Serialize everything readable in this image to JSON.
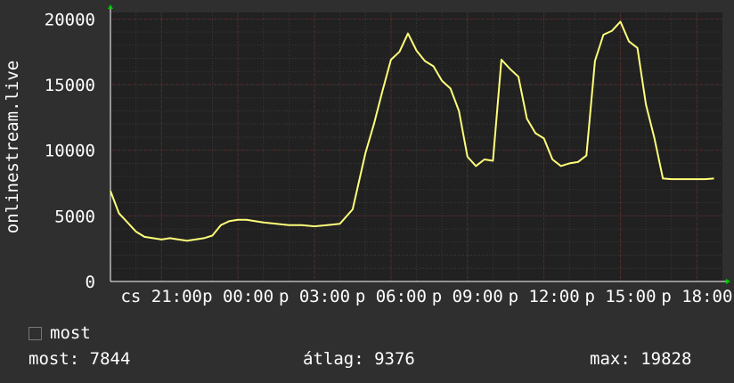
{
  "colors": {
    "background": "#2f2f2f",
    "canvas": "#212121",
    "grid_minor": "#3a3a3a",
    "grid_major": "#5a2a2a",
    "axis": "#ffffff",
    "arrow": "#00cc00",
    "series": "#ffff7a"
  },
  "chart_data": {
    "type": "line",
    "ylabel": "onlinestream.live",
    "ylim": [
      0,
      20500
    ],
    "y_ticks": [
      0,
      5000,
      10000,
      15000,
      20000
    ],
    "y_tick_labels": [
      "0",
      "5000",
      "10000",
      "15000",
      "20000"
    ],
    "x_range_hours": [
      19.0,
      19.0
    ],
    "x_tick_labels": [
      "cs 21:00",
      "p 00:00",
      "p 03:00",
      "p 06:00",
      "p 09:00",
      "p 12:00",
      "p 15:00",
      "p 18:00"
    ],
    "grid": true,
    "legend_position": "bottom-left",
    "series": [
      {
        "name": "most",
        "x": [
          "cs 19:00",
          "cs 19:20",
          "cs 19:40",
          "cs 20:00",
          "cs 20:20",
          "cs 20:40",
          "cs 21:00",
          "cs 21:20",
          "cs 21:40",
          "cs 22:00",
          "cs 22:20",
          "cs 22:40",
          "cs 23:00",
          "cs 23:20",
          "cs 23:40",
          "p 00:00",
          "p 00:20",
          "p 00:40",
          "p 01:00",
          "p 01:30",
          "p 02:00",
          "p 02:30",
          "p 03:00",
          "p 03:30",
          "p 04:00",
          "p 04:30",
          "p 05:00",
          "p 05:20",
          "p 05:40",
          "p 06:00",
          "p 06:20",
          "p 06:40",
          "p 07:00",
          "p 07:20",
          "p 07:40",
          "p 08:00",
          "p 08:20",
          "p 08:40",
          "p 09:00",
          "p 09:20",
          "p 09:40",
          "p 10:00",
          "p 10:20",
          "p 10:40",
          "p 11:00",
          "p 11:20",
          "p 11:40",
          "p 12:00",
          "p 12:20",
          "p 12:40",
          "p 13:00",
          "p 13:20",
          "p 13:40",
          "p 14:00",
          "p 14:20",
          "p 14:40",
          "p 15:00",
          "p 15:20",
          "p 15:40",
          "p 16:00",
          "p 16:20",
          "p 16:40",
          "p 17:00",
          "p 17:20",
          "p 17:40",
          "p 18:00",
          "p 18:20",
          "p 18:40"
        ],
        "values": [
          6900,
          5200,
          4500,
          3800,
          3400,
          3300,
          3200,
          3300,
          3200,
          3100,
          3200,
          3300,
          3500,
          4300,
          4600,
          4700,
          4700,
          4600,
          4500,
          4400,
          4300,
          4300,
          4200,
          4300,
          4400,
          5500,
          9800,
          12000,
          14500,
          16900,
          17500,
          18900,
          17600,
          16800,
          16400,
          15300,
          14700,
          13000,
          9500,
          8800,
          9300,
          9200,
          16900,
          16200,
          15600,
          12400,
          11300,
          10900,
          9300,
          8800,
          9000,
          9100,
          9600,
          16800,
          18800,
          19100,
          19800,
          18300,
          17800,
          13500,
          10900,
          7844,
          7800,
          7800,
          7800,
          7800,
          7800,
          7844
        ]
      }
    ]
  },
  "legend": {
    "series_label": "most"
  },
  "stats": {
    "current": "most: 7844",
    "average": "átlag: 9376",
    "max": "max: 19828"
  }
}
